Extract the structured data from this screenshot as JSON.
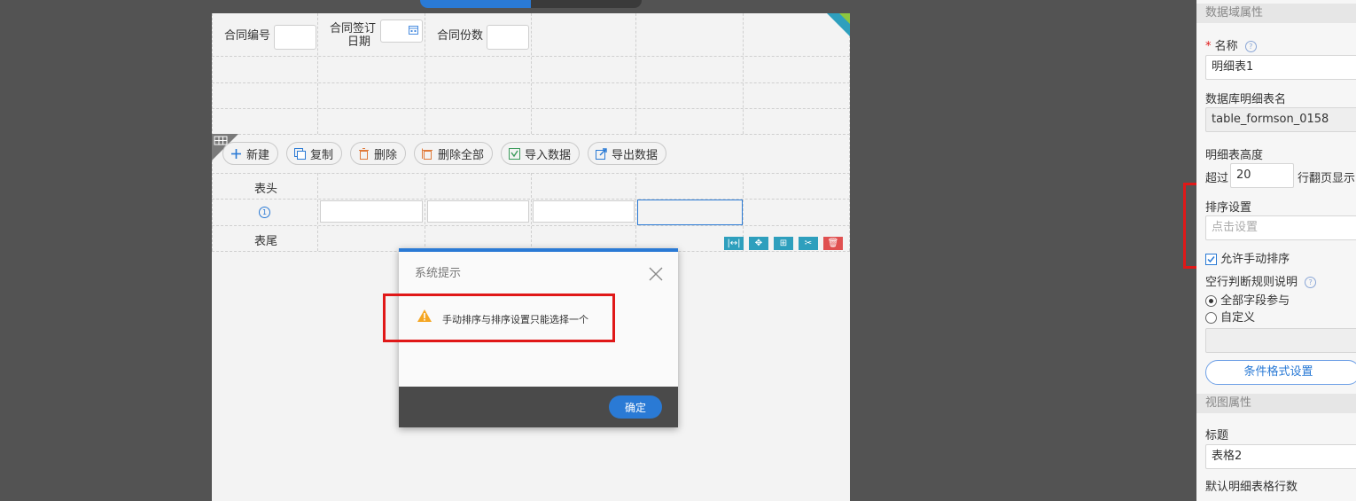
{
  "canvas": {
    "fields": [
      {
        "label": "合同编号"
      },
      {
        "label_line1": "合同签订",
        "label_line2": "日期"
      },
      {
        "label": "合同份数"
      }
    ],
    "toolbar": [
      "新建",
      "复制",
      "删除",
      "删除全部",
      "导入数据",
      "导出数据"
    ],
    "rows": {
      "header": "表头",
      "index": "1",
      "footer": "表尾"
    }
  },
  "dialog": {
    "title": "系统提示",
    "message": "手动排序与排序设置只能选择一个",
    "ok_label": "确定"
  },
  "panel": {
    "section_data": "数据域属性",
    "name_label": "名称",
    "name_required": "*",
    "name_value": "明细表1",
    "db_label": "数据库明细表名",
    "db_value": "table_formson_0158",
    "height_label": "明细表高度",
    "exceed_label": "超过",
    "exceed_value": "20",
    "paging_label": "行翻页显示",
    "sort_label": "排序设置",
    "sort_placeholder": "点击设置",
    "manual_sort_label": "允许手动排序",
    "empty_rule_label": "空行判断规则说明",
    "radio_all": "全部字段参与",
    "radio_custom": "自定义",
    "cond_format_btn": "条件格式设置",
    "section_view": "视图属性",
    "title_label": "标题",
    "title_value": "表格2",
    "default_rows_label": "默认明细表格行数"
  },
  "colors": {
    "accent": "#2a7ad5",
    "highlight": "#e01818",
    "warning": "#f5a623",
    "op_teal": "#2e9fbd",
    "op_red": "#e05050"
  }
}
